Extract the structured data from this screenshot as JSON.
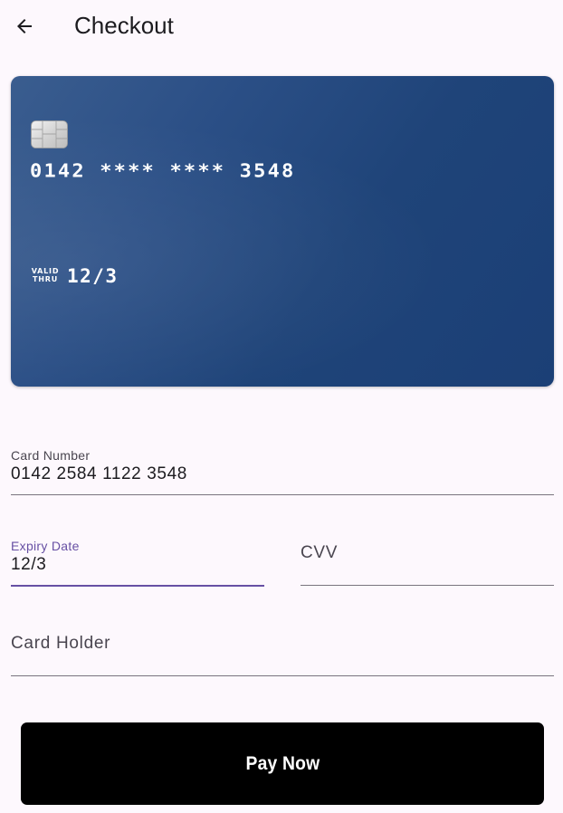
{
  "app_bar": {
    "back_icon": "arrow-left-icon",
    "title": "Checkout"
  },
  "card": {
    "chip_icon": "emv-chip-icon",
    "number_masked": "0142 **** **** 3548",
    "valid_label_line1": "VALID",
    "valid_label_line2": "THRU",
    "expiry": "12/3",
    "colors": {
      "gradient_start": "#3a5d8f",
      "gradient_end": "#1b3f76"
    }
  },
  "form": {
    "card_number": {
      "label": "Card Number",
      "value": "0142 2584 1122 3548"
    },
    "expiry_date": {
      "label": "Expiry Date",
      "value": "12/3",
      "focused": true
    },
    "cvv": {
      "label": "CVV",
      "value": ""
    },
    "card_holder": {
      "label": "Card Holder",
      "value": ""
    }
  },
  "pay_button": {
    "label": "Pay Now"
  },
  "colors": {
    "background": "#fdf8fd",
    "focus_accent": "#6750a4",
    "button_bg": "#000000",
    "button_text": "#ffffff"
  }
}
